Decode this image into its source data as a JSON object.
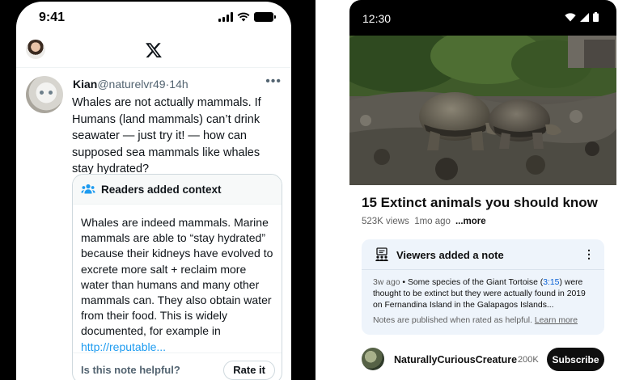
{
  "x_app": {
    "status_time": "9:41",
    "tweet": {
      "name": "Kian",
      "handle": "@naturelvr49",
      "separator": "·",
      "time": "14h",
      "more": "•••",
      "text": "Whales are not actually mammals. If Humans (land mammals) can’t drink seawater — just try it! — how can supposed sea mammals like whales stay hydrated?"
    },
    "note": {
      "title": "Readers added context",
      "body": "Whales are indeed mammals. Marine mammals are able to “stay hydrated” because their kidneys have evolved to excrete more salt + reclaim more water than humans and many other mammals can. They also obtain water from their food. This is widely documented, for example in ",
      "link": "http://reputable...",
      "helpful_prompt": "Is this note helpful?",
      "rate_label": "Rate it"
    }
  },
  "youtube_app": {
    "status_time": "12:30",
    "video": {
      "title": "15 Extinct animals you should know",
      "views": "523K views",
      "age": "1mo ago",
      "more_label": "...more"
    },
    "note": {
      "title": "Viewers added a note",
      "menu": "⋮",
      "ago": "3w ago",
      "bullet": "•",
      "text_a": "Some species of the Giant Tortoise (",
      "timestamp": "3:15",
      "text_b": ") were thought to be extinct but they were actually found in 2019 on Fernandina Island in the Galapagos Islands...",
      "footer": "Notes are published when rated as helpful.",
      "learn_more": "Learn more"
    },
    "channel": {
      "name": "NaturallyCuriousCreature",
      "subscribers": "200K",
      "subscribe_label": "Subscribe"
    }
  },
  "colors": {
    "x_link": "#1d9bf0",
    "yt_note_bg": "#eef4fb",
    "yt_timestamp": "#065fd4"
  }
}
